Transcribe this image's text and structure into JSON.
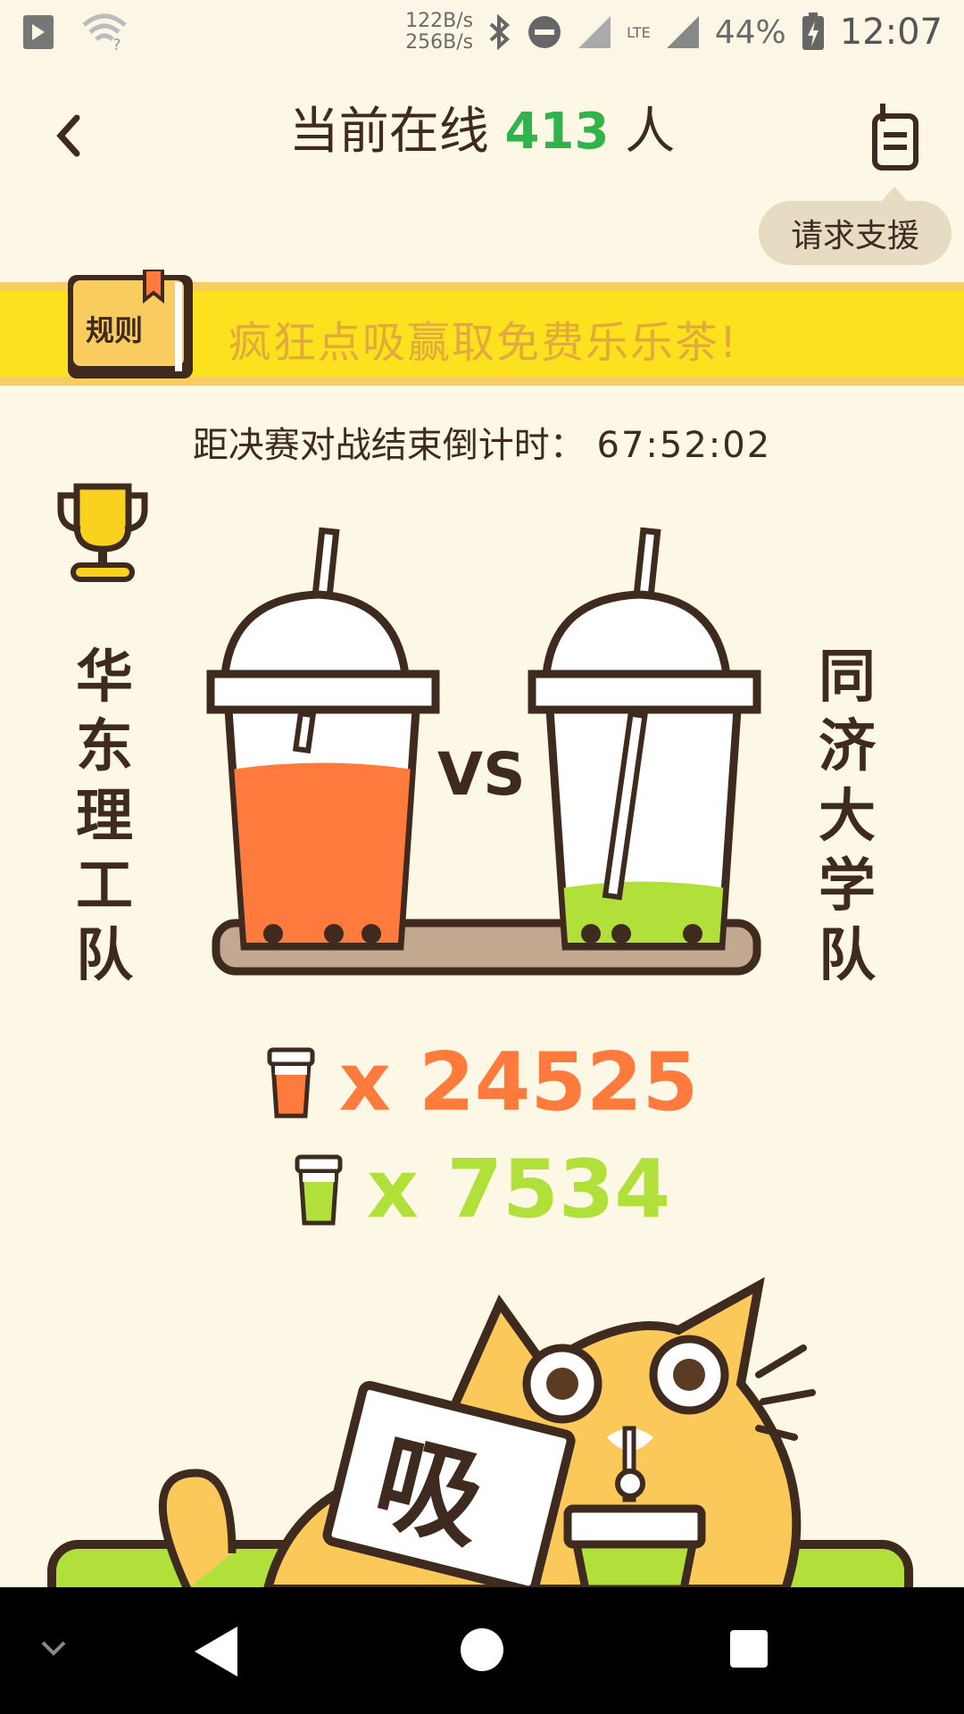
{
  "status_bar": {
    "net_up": "122B/s",
    "net_down": "256B/s",
    "lte": "LTE",
    "battery": "44%",
    "time": "12:07"
  },
  "header": {
    "title_prefix": "当前在线",
    "online_count": "413",
    "title_suffix": "人",
    "support_label": "请求支援"
  },
  "banner": {
    "rules_label": "规则",
    "text": "疯狂点吸赢取免费乐乐茶!"
  },
  "countdown": {
    "label": "距决赛对战结束倒计时：",
    "value": "67:52:02"
  },
  "teams": {
    "left": [
      "华",
      "东",
      "理",
      "工",
      "队"
    ],
    "right": [
      "同",
      "济",
      "大",
      "学",
      "队"
    ],
    "vs": "VS"
  },
  "scores": {
    "left_prefix": "x",
    "left_value": "24525",
    "right_prefix": "x",
    "right_value": "7534",
    "left_fill_percent": 76,
    "right_fill_percent": 24
  },
  "mascot": {
    "sign": "吸"
  },
  "colors": {
    "accent_green": "#2fb34a",
    "left_tea": "#ff7a3d",
    "right_tea": "#b2e03a",
    "banner_yellow": "#fce11f"
  },
  "nav": {
    "icons": [
      "chevron-down-icon",
      "back-triangle-icon",
      "home-circle-icon",
      "recents-square-icon"
    ]
  }
}
